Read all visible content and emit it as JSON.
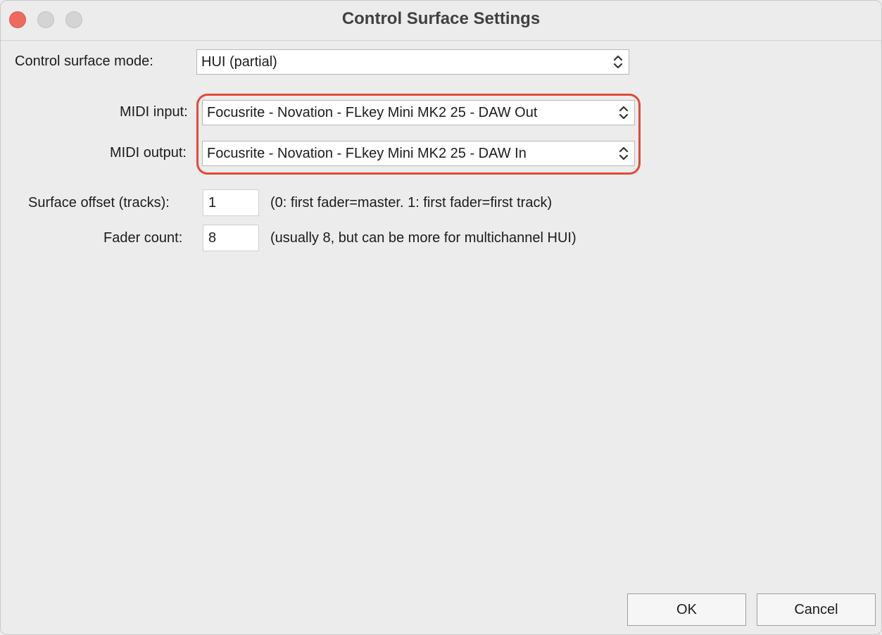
{
  "window": {
    "title": "Control Surface Settings"
  },
  "mode": {
    "label": "Control surface mode:",
    "value": "HUI (partial)"
  },
  "midi_input": {
    "label": "MIDI input:",
    "value": "Focusrite - Novation - FLkey Mini MK2 25 - DAW Out"
  },
  "midi_output": {
    "label": "MIDI output:",
    "value": "Focusrite - Novation - FLkey Mini MK2 25 - DAW In"
  },
  "surface_offset": {
    "label": "Surface offset (tracks):",
    "value": "1",
    "hint": "(0: first fader=master. 1: first fader=first track)"
  },
  "fader_count": {
    "label": "Fader count:",
    "value": "8",
    "hint": "(usually 8, but can be more for multichannel HUI)"
  },
  "buttons": {
    "ok": "OK",
    "cancel": "Cancel"
  },
  "colors": {
    "highlight": "#e04b36",
    "close_button": "#ee6a5e"
  }
}
